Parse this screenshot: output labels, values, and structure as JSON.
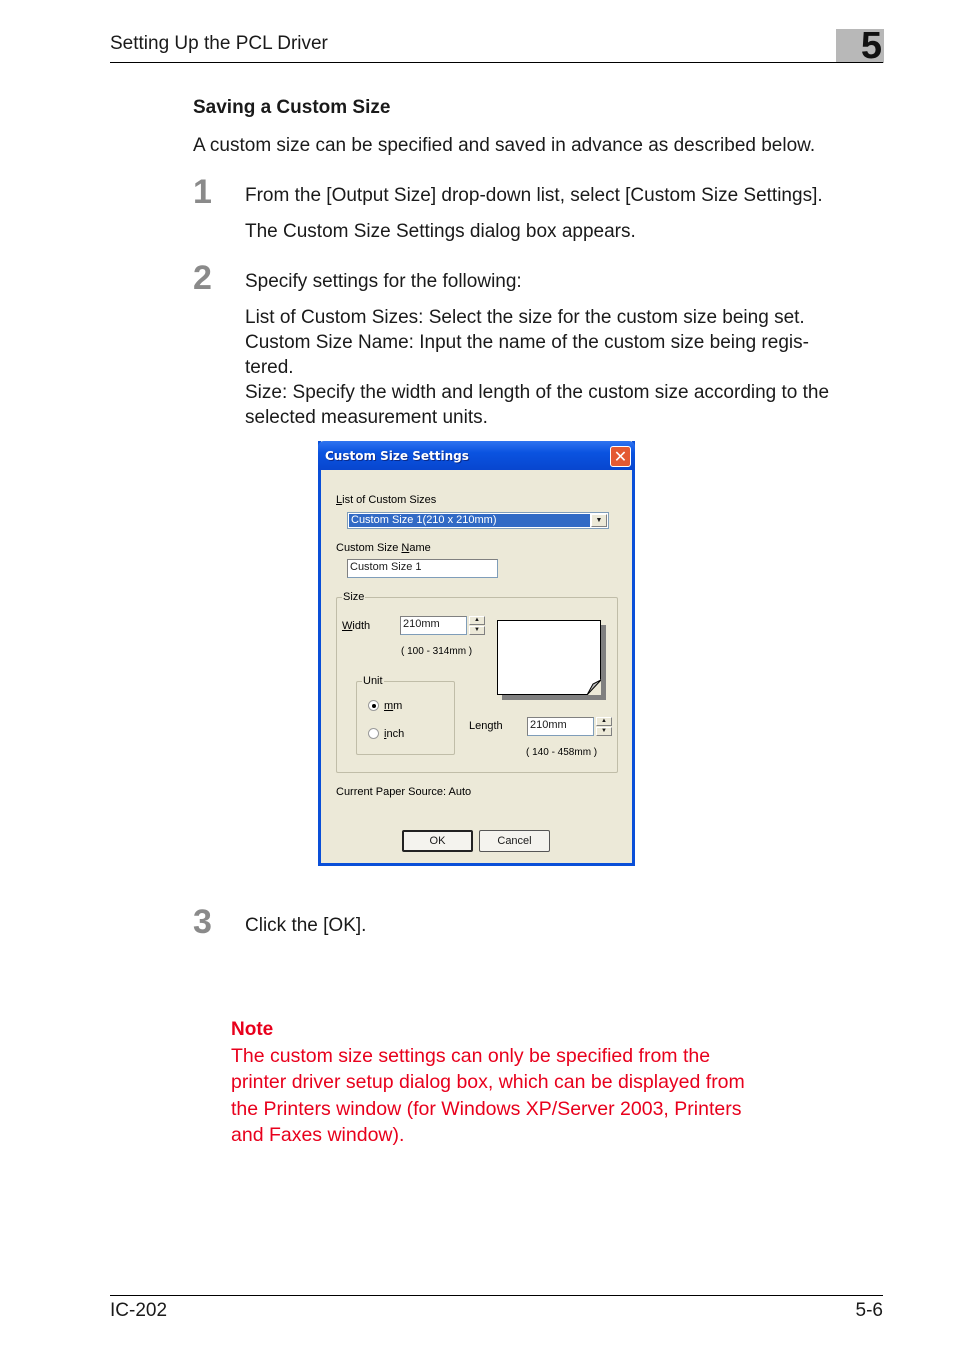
{
  "header": {
    "title": "Setting Up the PCL Driver",
    "chapter": "5"
  },
  "section": {
    "title": "Saving a Custom Size",
    "intro": "A custom size can be specified and saved in advance as described below."
  },
  "steps": [
    {
      "number": "1",
      "lines": [
        "From the [Output Size] drop-down list, select [Custom Size Settings].",
        "The Custom Size Settings dialog box appears."
      ]
    },
    {
      "number": "2",
      "lead": "Specify settings for the following:",
      "details": [
        "List of Custom Sizes: Select the size for the custom size being set.",
        "Custom Size Name: Input the name of the custom size being regis-",
        "tered.",
        "Size: Specify the width and length of the custom size according to the",
        "selected measurement units."
      ]
    },
    {
      "number": "3",
      "lines": [
        "Click the [OK]."
      ]
    }
  ],
  "dialog": {
    "title": "Custom Size Settings",
    "close_icon": "close-icon",
    "list_label_key": "L",
    "list_label_rest": "ist of Custom Sizes",
    "list_selected": "Custom Size 1(210 x 210mm)",
    "name_label_pre": "Custom Size ",
    "name_label_key": "N",
    "name_label_rest": "ame",
    "name_value": "Custom Size 1",
    "size_group": "Size",
    "width_label_key": "W",
    "width_label_rest": "idth",
    "width_value": "210mm",
    "width_range": "( 100 - 314mm )",
    "unit_group": "Unit",
    "unit_options": [
      {
        "key": "m",
        "rest": "m",
        "selected": true
      },
      {
        "key": "i",
        "rest": "nch",
        "selected": false
      }
    ],
    "length_label_pre": "Len",
    "length_label_key": "g",
    "length_label_rest": "th",
    "length_value": "210mm",
    "length_range": "( 140 - 458mm )",
    "paper_source": "Current Paper Source: Auto",
    "ok_label": "OK",
    "cancel_label": "Cancel"
  },
  "note": {
    "title": "Note",
    "lines": [
      "The custom size settings can only be specified from the",
      "printer driver setup dialog box, which can be displayed from",
      "the Printers window (for Windows XP/Server 2003, Printers",
      "and Faxes window)."
    ]
  },
  "footer": {
    "left": "IC-202",
    "right": "5-6"
  },
  "colors": {
    "note": "#e8001c",
    "titlebar": "#0a53e0",
    "selection": "#316ac5",
    "dialog_bg": "#ece9d8"
  }
}
